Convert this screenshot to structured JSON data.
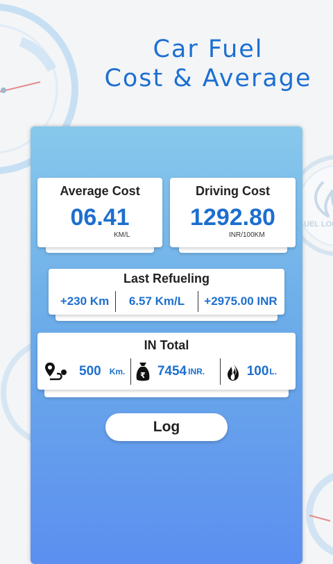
{
  "header": {
    "title_line1": "Car Fuel",
    "title_line2": "Cost & Average"
  },
  "decor": {
    "watermark_text": "UEL LOG"
  },
  "average_cost": {
    "title": "Average Cost",
    "value": "06.41",
    "unit": "KM/L"
  },
  "driving_cost": {
    "title": "Driving Cost",
    "value": "1292.80",
    "unit": "INR/100KM"
  },
  "last_refueling": {
    "title": "Last Refueling",
    "distance": "+230 Km",
    "average": "6.57 Km/L",
    "cost": "+2975.00 INR"
  },
  "in_total": {
    "title": "IN Total",
    "distance_value": "500",
    "distance_unit": "Km.",
    "money_value": "7454",
    "money_unit": "INR.",
    "fuel_value": "100",
    "fuel_unit": "L."
  },
  "actions": {
    "log_label": "Log"
  },
  "colors": {
    "accent": "#1d6fce",
    "panel_top": "#87c8ec",
    "panel_bottom": "#5c8ff0"
  },
  "icons": {
    "route": "route-icon",
    "money": "money-bag-icon",
    "fuel": "flame-icon"
  }
}
